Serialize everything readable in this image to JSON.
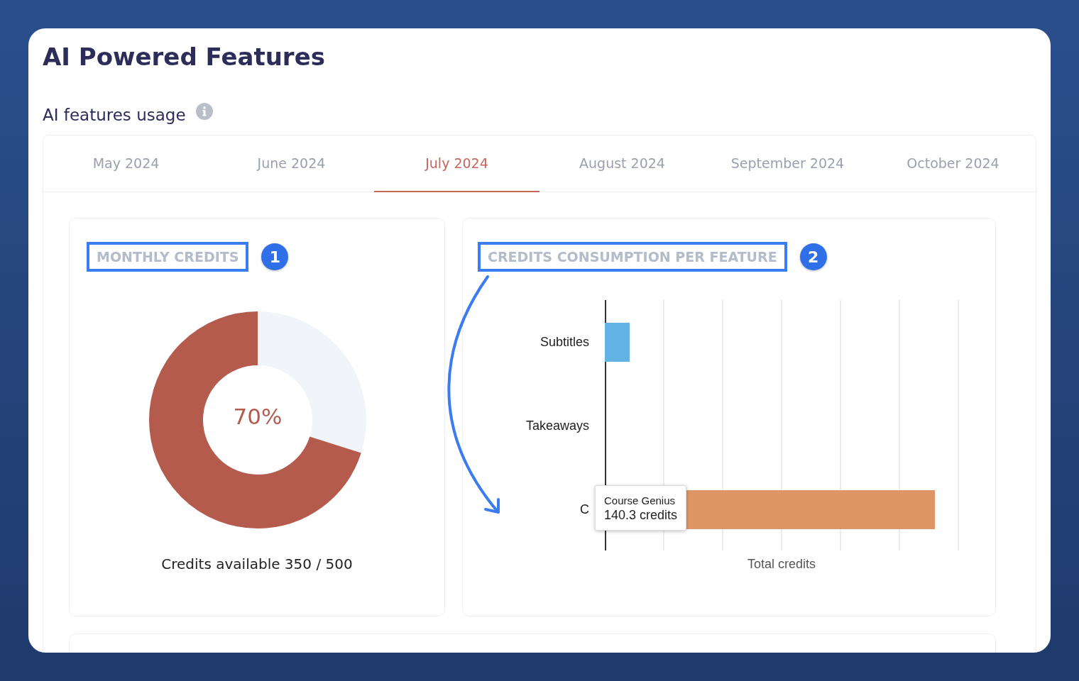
{
  "page": {
    "title": "AI Powered Features",
    "section_title": "AI features usage"
  },
  "tabs": [
    {
      "label": "May 2024",
      "selected": false
    },
    {
      "label": "June 2024",
      "selected": false
    },
    {
      "label": "July 2024",
      "selected": true
    },
    {
      "label": "August 2024",
      "selected": false
    },
    {
      "label": "September 2024",
      "selected": false
    },
    {
      "label": "October 2024",
      "selected": false
    }
  ],
  "monthly_credits": {
    "heading": "MONTHLY CREDITS",
    "badge": "1",
    "level": 0.7,
    "percent": "70%",
    "caption": "Credits available 350 / 500"
  },
  "consumption": {
    "heading": "CREDITS CONSUMPTION PER FEATURE",
    "badge": "2",
    "xlabel": "Total credits",
    "bars": [
      {
        "label": "Subtitles",
        "color": "#62b3e4"
      },
      {
        "label": "Takeaways"
      },
      {
        "label": "C",
        "color": "#de9666"
      }
    ],
    "tooltip": {
      "title": "Course Genius",
      "value": "140.3 credits"
    }
  }
}
